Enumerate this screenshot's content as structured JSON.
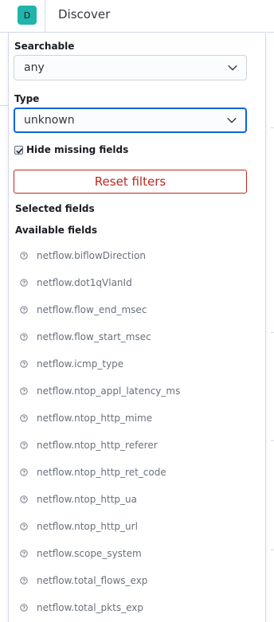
{
  "header": {
    "app_badge": "D",
    "title": "Discover"
  },
  "filters": {
    "searchable_label": "Searchable",
    "searchable_value": "any",
    "type_label": "Type",
    "type_value": "unknown",
    "hide_missing_label": "Hide missing fields",
    "hide_missing_checked": true,
    "reset_label": "Reset filters"
  },
  "sections": {
    "selected_title": "Selected fields",
    "available_title": "Available fields"
  },
  "available_fields": [
    "netflow.biflowDirection",
    "netflow.dot1qVlanId",
    "netflow.flow_end_msec",
    "netflow.flow_start_msec",
    "netflow.icmp_type",
    "netflow.ntop_appl_latency_ms",
    "netflow.ntop_http_mime",
    "netflow.ntop_http_referer",
    "netflow.ntop_http_ret_code",
    "netflow.ntop_http_ua",
    "netflow.ntop_http_url",
    "netflow.scope_system",
    "netflow.total_flows_exp",
    "netflow.total_pkts_exp"
  ],
  "icons": {
    "field_type": "question-circle-icon",
    "select_arrow": "chevron-down-icon"
  },
  "colors": {
    "badge": "#20b4aa",
    "focus": "#0b64dd",
    "danger": "#bd271e"
  }
}
